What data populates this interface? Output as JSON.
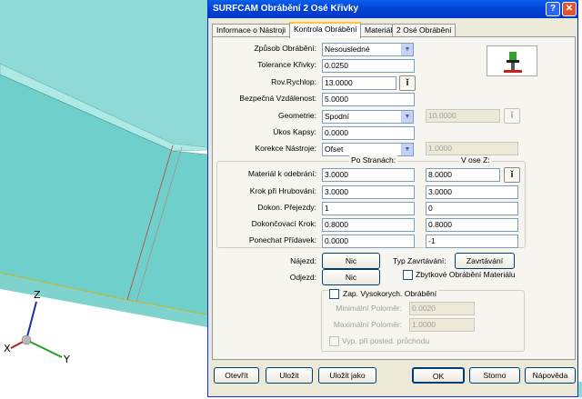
{
  "viewport": {
    "axes": {
      "z": "Z",
      "x": "X",
      "y": "Y"
    }
  },
  "dialog": {
    "title": "SURFCAM Obrábění 2 Osé Křivky",
    "help": "?",
    "close": "✕",
    "tabs": [
      "Informace o Nástroji",
      "Kontrola Obrábění",
      "Materiál",
      "2 Osé Obrábění"
    ],
    "active_tab": 1,
    "fields": {
      "zpusob_label": "Způsob Obrábění:",
      "zpusob_value": "Nesousledné",
      "tolerance_label": "Tolerance Křivky:",
      "tolerance_value": "0.0250",
      "rovrychlop_label": "Rov.Rychlop:",
      "rovrychlop_value": "13.0000",
      "bezpecna_label": "Bezpečná Vzdálenost:",
      "bezpecna_value": "5.0000",
      "geometrie_label": "Geometrie:",
      "geometrie_value": "Spodní",
      "geometrie_extra": "10.0000",
      "ukos_label": "Úkos Kapsy:",
      "ukos_value": "0.0000",
      "korekce_label": "Korekce Nástroje:",
      "korekce_value": "Ofset",
      "korekce_extra": "1.0000"
    },
    "grid": {
      "col_stranach": "Po Stranách:",
      "col_osez": "V ose Z:",
      "rows": [
        {
          "label": "Materiál k odebrání:",
          "stranach": "3.0000",
          "osez": "8.0000"
        },
        {
          "label": "Krok při Hrubování:",
          "stranach": "3.0000",
          "osez": "3.0000"
        },
        {
          "label": "Dokon. Přejezdy:",
          "stranach": "1",
          "osez": "0"
        },
        {
          "label": "Dokončovací Krok:",
          "stranach": "0.8000",
          "osez": "0.8000"
        },
        {
          "label": "Ponechat Přídavek:",
          "stranach": "0.0000",
          "osez": "-1"
        }
      ]
    },
    "motion": {
      "najezd_label": "Nájezd:",
      "najezd_button": "Nic",
      "odjezd_label": "Odjezd:",
      "odjezd_button": "Nic",
      "typ_label": "Typ Zavrtávání:",
      "typ_button": "Zavrtávání",
      "zbytkove_label": "Zbytkové Obrábění Materiálu"
    },
    "highspeed": {
      "title": "Zap. Vysokorych. Obrábění",
      "min_label": "Minimální Poloměr:",
      "min_value": "0.0020",
      "max_label": "Maximální Poloměr:",
      "max_value": "1.0000",
      "vyp_label": "Vyp. při posled. průchodu"
    },
    "buttons": [
      "Otevřít",
      "Uložit",
      "Uložit jako",
      "OK",
      "Storno",
      "Nápověda"
    ]
  }
}
